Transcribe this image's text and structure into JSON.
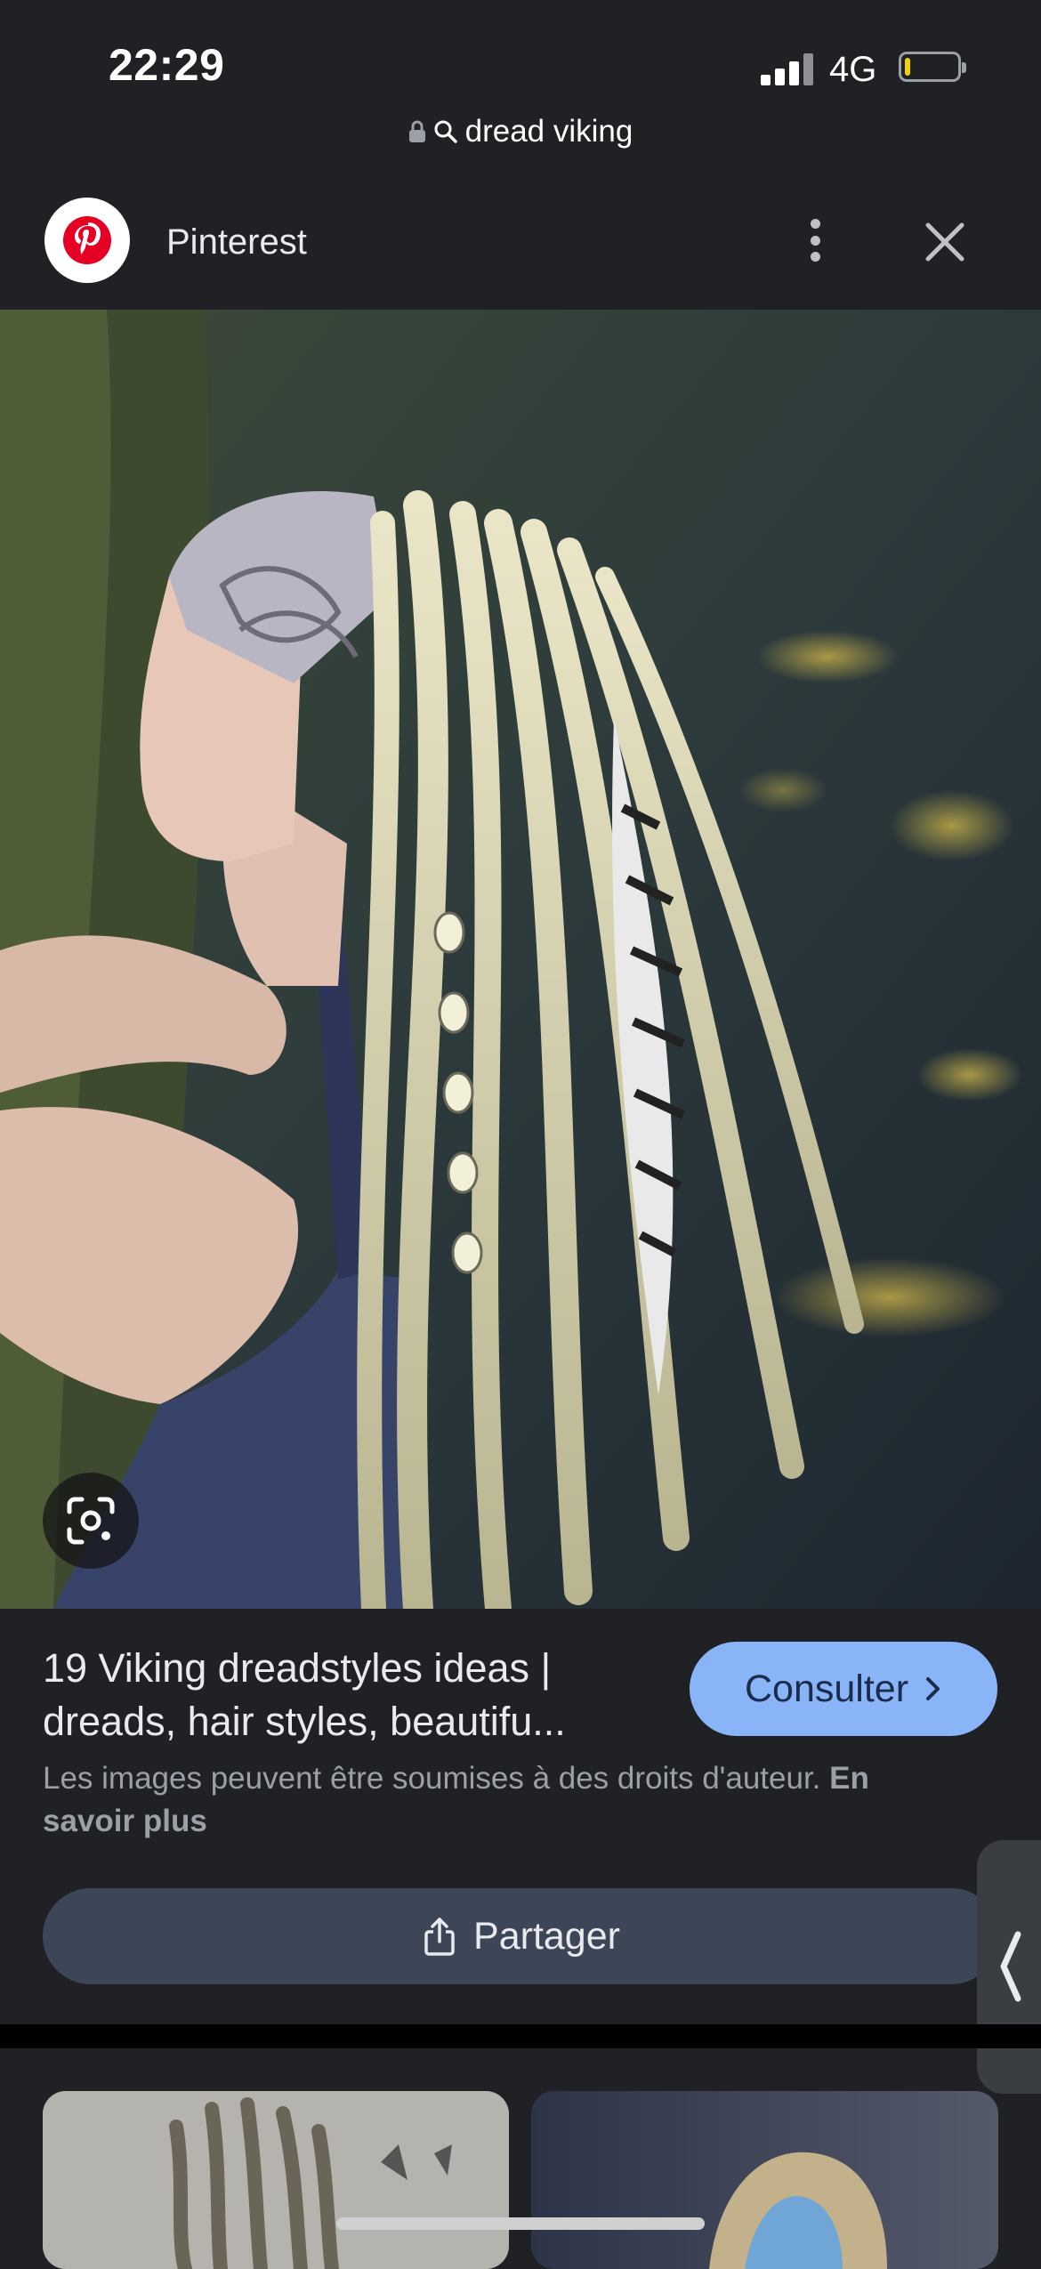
{
  "status_bar": {
    "time": "22:29",
    "network": "4G",
    "battery_level": 0.1
  },
  "url_bar": {
    "query": "dread viking"
  },
  "header": {
    "site_name": "Pinterest",
    "logo_icon": "pinterest-logo-icon",
    "more_icon": "more-vertical-icon",
    "close_icon": "close-icon"
  },
  "result": {
    "title_line1": "19 Viking dreadstyles ideas |",
    "title_line2": "dreads, hair styles, beautifu...",
    "visit_label": "Consulter",
    "copyright_text": "Les images peuvent être soumises à des droits d'auteur.",
    "learn_more": "En savoir plus",
    "share_label": "Partager"
  },
  "colors": {
    "background": "#202124",
    "accent": "#8ab4f8",
    "share_button": "#3c4656",
    "pinterest_red": "#e60023"
  }
}
